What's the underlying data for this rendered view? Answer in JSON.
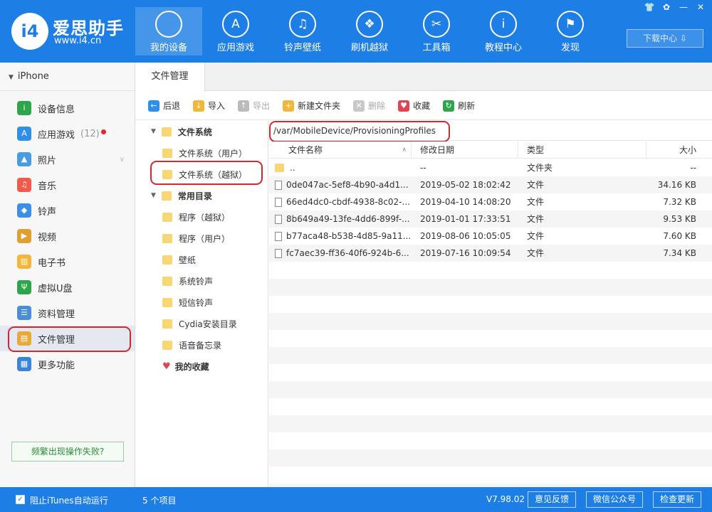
{
  "app": {
    "logo_badge": "i4",
    "title": "爱思助手",
    "url": "www.i4.cn"
  },
  "nav": [
    {
      "label": "我的设备",
      "icon": "apple-icon",
      "glyph": "",
      "active": true
    },
    {
      "label": "应用游戏",
      "icon": "app-store-icon",
      "glyph": "A"
    },
    {
      "label": "铃声壁纸",
      "icon": "music-folder-icon",
      "glyph": "♫"
    },
    {
      "label": "刷机越狱",
      "icon": "dropbox-icon",
      "glyph": "❖"
    },
    {
      "label": "工具箱",
      "icon": "tools-icon",
      "glyph": "✂"
    },
    {
      "label": "教程中心",
      "icon": "info-icon",
      "glyph": "i"
    },
    {
      "label": "发现",
      "icon": "flag-icon",
      "glyph": "⚑"
    }
  ],
  "download_center": "下载中心",
  "device_name": "iPhone",
  "sidebar": [
    {
      "label": "设备信息",
      "icon": "device-info-icon",
      "glyph": "i",
      "color": "#2ea54a"
    },
    {
      "label": "应用游戏",
      "icon": "apps-icon",
      "glyph": "A",
      "color": "#2f8fe8",
      "count": "(12)",
      "badge": true
    },
    {
      "label": "照片",
      "icon": "photos-icon",
      "glyph": "▲",
      "color": "#4a9be2",
      "chevron": true
    },
    {
      "label": "音乐",
      "icon": "music-icon",
      "glyph": "♫",
      "color": "#f25a4b"
    },
    {
      "label": "铃声",
      "icon": "bell-icon",
      "glyph": "◆",
      "color": "#3b8fe6"
    },
    {
      "label": "视频",
      "icon": "video-icon",
      "glyph": "▶",
      "color": "#e0a030"
    },
    {
      "label": "电子书",
      "icon": "book-icon",
      "glyph": "▥",
      "color": "#f0b73a"
    },
    {
      "label": "虚拟U盘",
      "icon": "usb-icon",
      "glyph": "Ψ",
      "color": "#2ea54a"
    },
    {
      "label": "资料管理",
      "icon": "data-icon",
      "glyph": "☰",
      "color": "#4a8fd6"
    },
    {
      "label": "文件管理",
      "icon": "file-manager-icon",
      "glyph": "▤",
      "color": "#e8a93a",
      "active": true
    },
    {
      "label": "更多功能",
      "icon": "more-icon",
      "glyph": "▦",
      "color": "#3a84d8"
    }
  ],
  "help_button": "频繁出现操作失败?",
  "tab": "文件管理",
  "toolbar": [
    {
      "label": "后退",
      "icon": "back-icon",
      "glyph": "←",
      "color": "#2f8fe8"
    },
    {
      "label": "导入",
      "icon": "import-icon",
      "glyph": "↓",
      "color": "#f0b73a"
    },
    {
      "label": "导出",
      "icon": "export-icon",
      "glyph": "↑",
      "color": "#bbbbbb",
      "disabled": true
    },
    {
      "label": "新建文件夹",
      "icon": "new-folder-icon",
      "glyph": "+",
      "color": "#f0b73a"
    },
    {
      "label": "删除",
      "icon": "delete-icon",
      "glyph": "✕",
      "color": "#c8c8c8",
      "disabled": true
    },
    {
      "label": "收藏",
      "icon": "heart-icon",
      "glyph": "♥",
      "color": "#e0454f"
    },
    {
      "label": "刷新",
      "icon": "refresh-icon",
      "glyph": "↻",
      "color": "#2ea54a"
    }
  ],
  "tree": [
    {
      "label": "文件系统",
      "level": 0,
      "expanded": true
    },
    {
      "label": "文件系统（用户）",
      "level": 1
    },
    {
      "label": "文件系统（越狱）",
      "level": 1,
      "selected": true
    },
    {
      "label": "常用目录",
      "level": 0,
      "expanded": true
    },
    {
      "label": "程序（越狱）",
      "level": 1
    },
    {
      "label": "程序（用户）",
      "level": 1
    },
    {
      "label": "壁纸",
      "level": 1
    },
    {
      "label": "系统铃声",
      "level": 1
    },
    {
      "label": "短信铃声",
      "level": 1
    },
    {
      "label": "Cydia安装目录",
      "level": 1
    },
    {
      "label": "语音备忘录",
      "level": 1
    },
    {
      "label": "我的收藏",
      "level": 0,
      "favorite": true
    }
  ],
  "path": "/var/MobileDevice/ProvisioningProfiles",
  "columns": {
    "name": "文件名称",
    "date": "修改日期",
    "type": "类型",
    "size": "大小"
  },
  "files": [
    {
      "name": "..",
      "date": "--",
      "type": "文件夹",
      "size": "--",
      "folder": true
    },
    {
      "name": "0de047ac-5ef8-4b90-a4d1...",
      "date": "2019-05-02 18:02:42",
      "type": "文件",
      "size": "34.16 KB"
    },
    {
      "name": "66ed4dc0-cbdf-4938-8c02-...",
      "date": "2019-04-10 14:08:20",
      "type": "文件",
      "size": "7.32 KB"
    },
    {
      "name": "8b649a49-13fe-4dd6-899f-...",
      "date": "2019-01-01 17:33:51",
      "type": "文件",
      "size": "9.53 KB"
    },
    {
      "name": "b77aca48-b538-4d85-9a11...",
      "date": "2019-08-06 10:05:05",
      "type": "文件",
      "size": "7.60 KB"
    },
    {
      "name": "fc7aec39-ff36-40f6-924b-6...",
      "date": "2019-07-16 10:09:54",
      "type": "文件",
      "size": "7.34 KB"
    }
  ],
  "status": {
    "itunes_label": "阻止iTunes自动运行",
    "itunes_checked": true,
    "items_count": "5 个项目",
    "version": "V7.98.02",
    "feedback": "意见反馈",
    "wechat": "微信公众号",
    "update": "检查更新"
  }
}
